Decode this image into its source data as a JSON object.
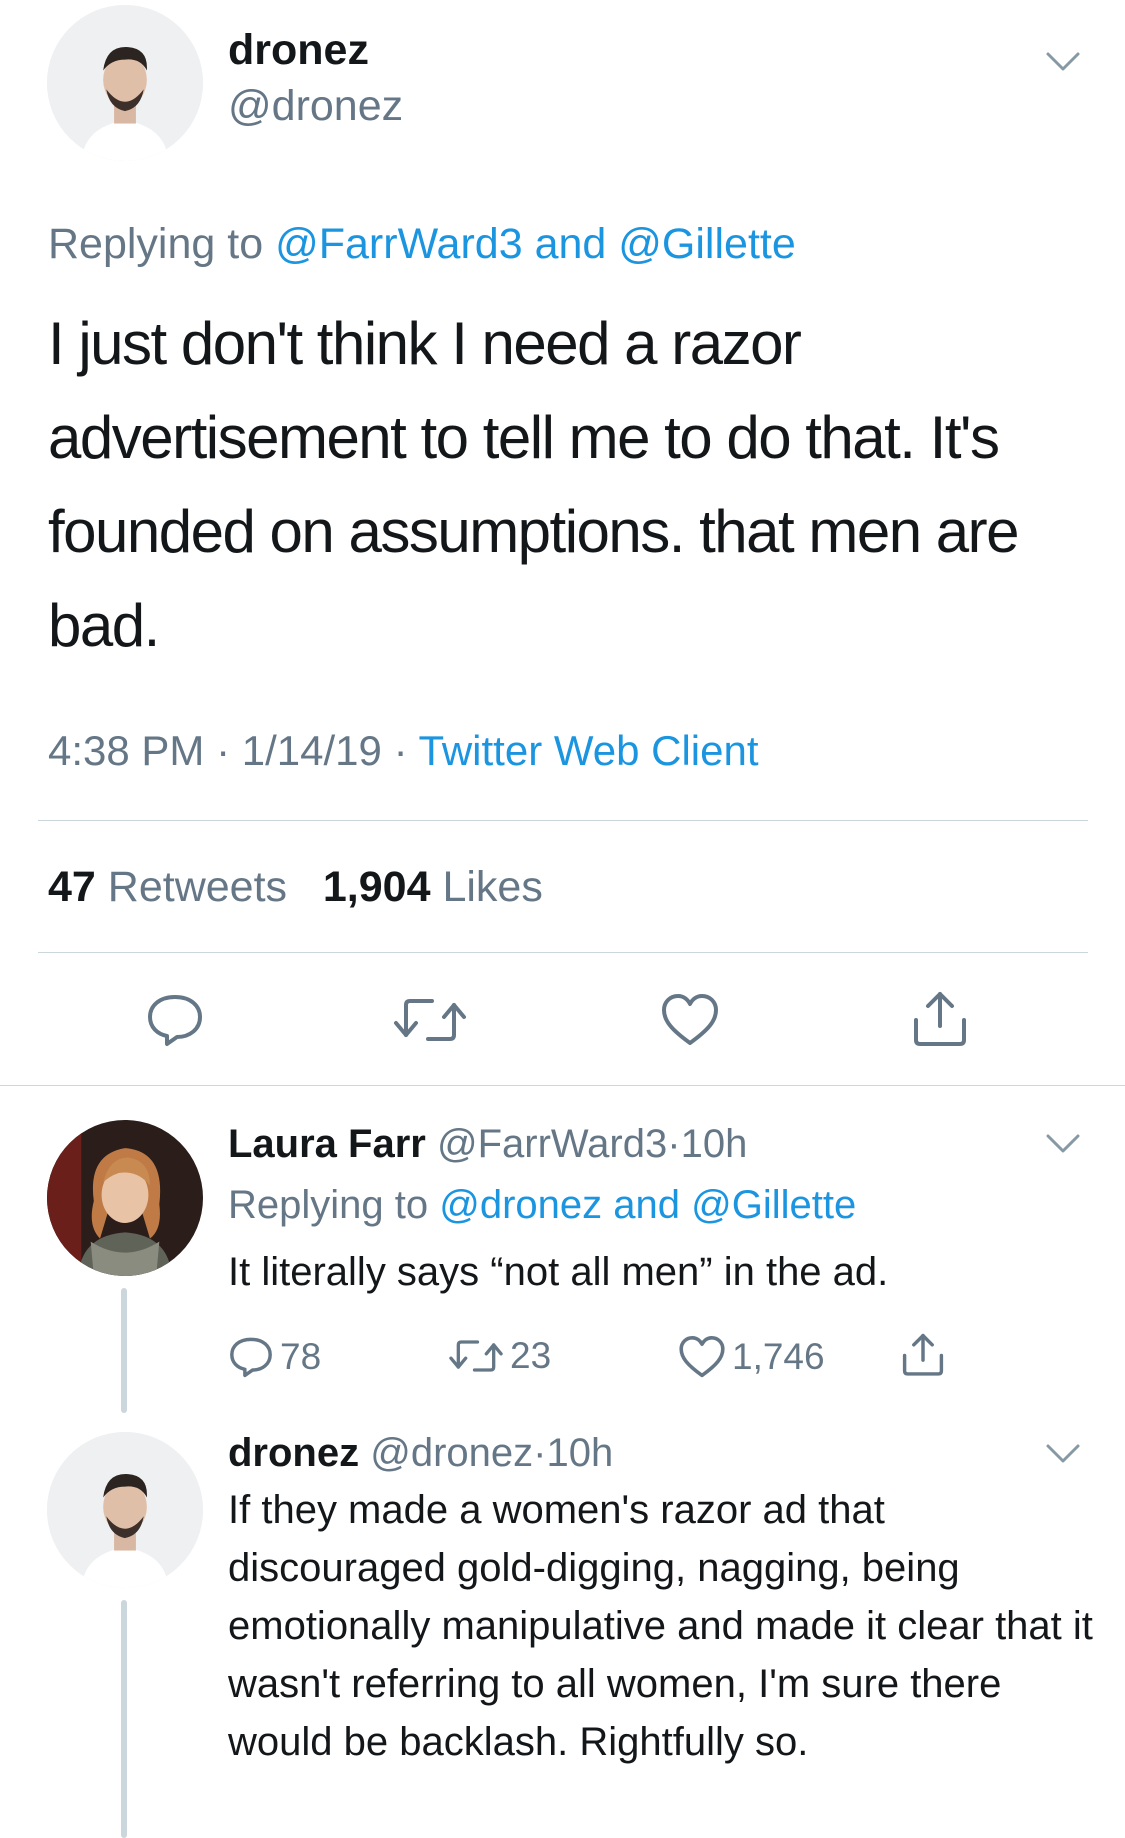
{
  "main_tweet": {
    "name": "dronez",
    "handle": "@dronez",
    "reply_prefix": "Replying to",
    "reply_user1": "@FarrWard3",
    "reply_and": "and",
    "reply_user2": "@Gillette",
    "text": "I just don't think I need a razor advertisement to tell me to do that. It's founded on assumptions. that men are bad.",
    "time": "4:38 PM",
    "date": "1/14/19",
    "client": "Twitter Web Client",
    "retweet_count": "47",
    "retweet_label": "Retweets",
    "like_count": "1,904",
    "like_label": "Likes"
  },
  "replies": [
    {
      "name": "Laura Farr",
      "handle": "@FarrWard3",
      "time": "10h",
      "reply_prefix": "Replying to",
      "reply_user1": "@dronez",
      "reply_and": "and",
      "reply_user2": "@Gillette",
      "text": "It literally says “not all men” in the ad.",
      "reply_count": "78",
      "retweet_count": "23",
      "like_count": "1,746"
    },
    {
      "name": "dronez",
      "handle": "@dronez",
      "time": "10h",
      "text": "If they made a women's razor ad that discouraged gold-digging, nagging, being emotionally manipulative and made it clear that it wasn't referring to all women, I'm sure there would be backlash. Rightfully so."
    }
  ],
  "separator": "·",
  "colors": {
    "link": "#1b95e0",
    "secondary_text": "#657786",
    "divider": "#ccd6dd",
    "primary_text": "#14171a"
  },
  "icons": [
    "chevron-down-icon",
    "reply-icon",
    "retweet-icon",
    "like-icon",
    "share-icon"
  ]
}
